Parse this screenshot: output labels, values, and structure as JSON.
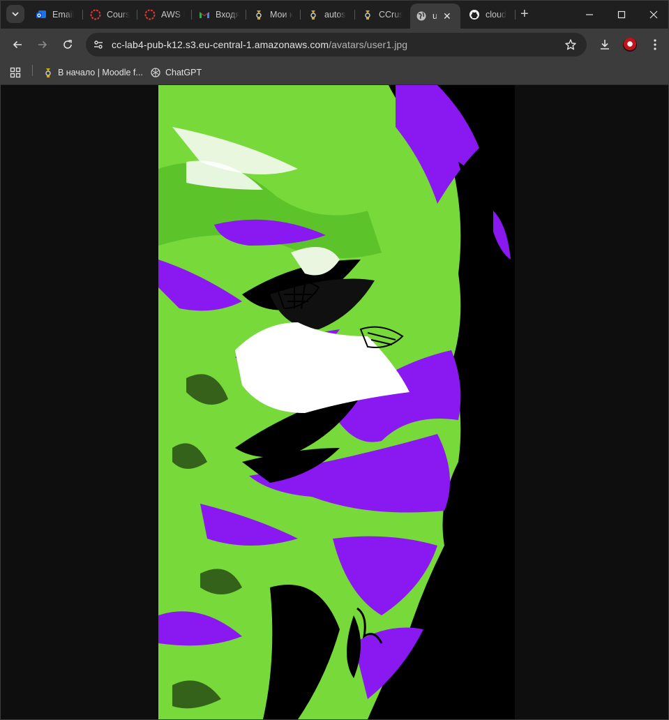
{
  "colors": {
    "tabstrip": "#1f1f1f",
    "toolbar": "#3c3c3c",
    "omnibox": "#282828",
    "page_bg": "#0e0e0e",
    "image_green": "#77d93a",
    "image_purple": "#8a18f0"
  },
  "tab_search_icon": "chevron-down-icon",
  "tabs": [
    {
      "title": "Email",
      "icon": "outlook-icon"
    },
    {
      "title": "Cours",
      "icon": "red-circle-icon"
    },
    {
      "title": "AWS I",
      "icon": "red-circle-icon"
    },
    {
      "title": "Входя",
      "icon": "gmail-icon"
    },
    {
      "title": "Мои к",
      "icon": "moodle-icon"
    },
    {
      "title": "autos",
      "icon": "moodle-icon"
    },
    {
      "title": "CCrus",
      "icon": "moodle-icon"
    },
    {
      "title": "u",
      "icon": "globe-icon",
      "active": true,
      "close": "✕"
    },
    {
      "title": "cloud",
      "icon": "github-icon"
    }
  ],
  "new_tab": "+",
  "window_controls": [
    "minimize-icon",
    "maximize-icon",
    "close-icon"
  ],
  "address": {
    "host": "cc-lab4-pub-k12.s3.eu-central-1.amazonaws.com",
    "path": "/avatars/user1.jpg"
  },
  "bookmarks": [
    {
      "label": "В начало | Moodle f...",
      "icon": "moodle-icon"
    },
    {
      "label": "ChatGPT",
      "icon": "chatgpt-icon"
    }
  ],
  "image": {
    "description_icon": "avatar-image"
  }
}
